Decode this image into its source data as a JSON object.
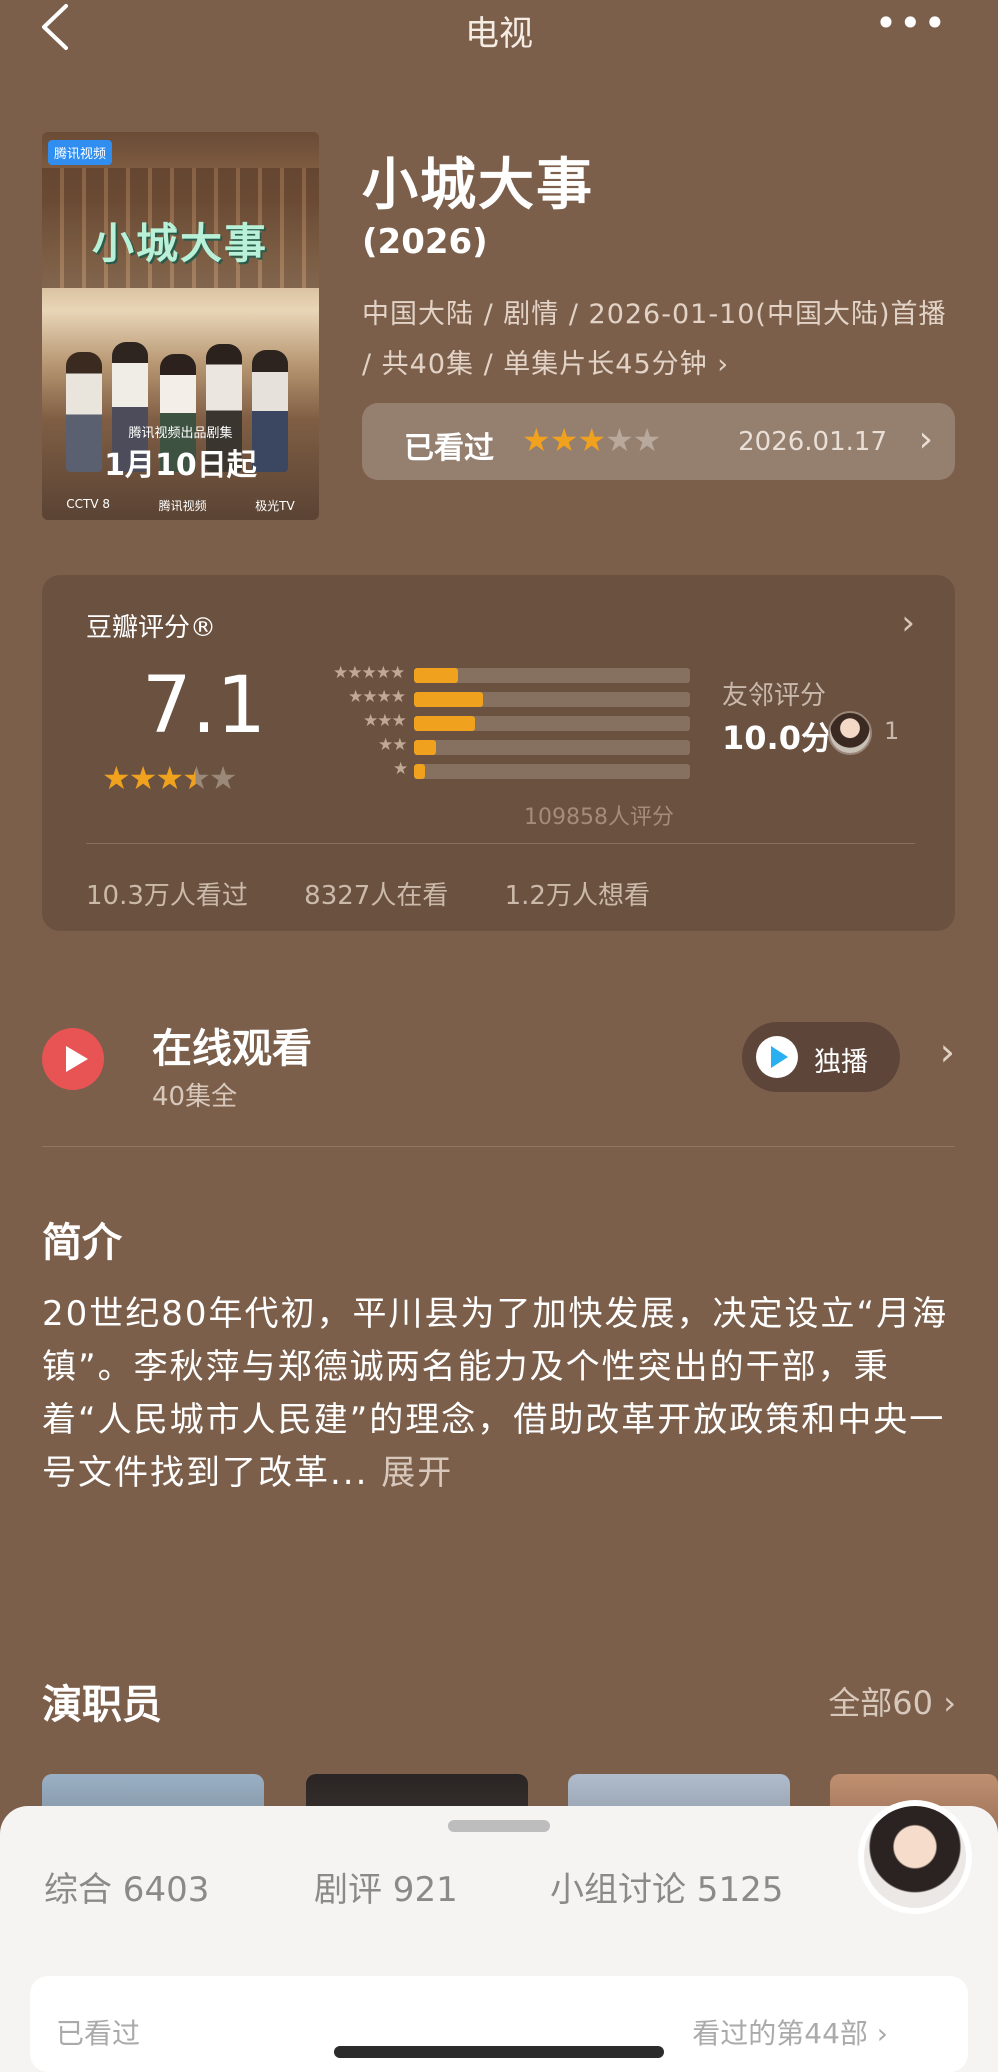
{
  "header": {
    "title": "电视",
    "more": "•••"
  },
  "poster": {
    "tag": "腾讯视频",
    "logo": "小城大事",
    "caption_small": "腾讯视频出品剧集",
    "caption_date": "1月10日起",
    "footer": [
      "CCTV 8",
      "腾讯视频",
      "极光TV"
    ]
  },
  "show": {
    "title": "小城大事",
    "year": "(2026)",
    "meta": "中国大陆 / 剧情 / 2026-01-10(中国大陆)首播 / 共40集 / 单集片长45分钟 ›"
  },
  "watched": {
    "label": "已看过",
    "user_stars": 3,
    "max_stars": 5,
    "date": "2026.01.17",
    "chevron": "›"
  },
  "rating": {
    "label": "豆瓣评分®",
    "score": "7.1",
    "stars": 3.5,
    "distribution": [
      {
        "stars": "★★★★★",
        "fraction": 0.16
      },
      {
        "stars": "★★★★",
        "fraction": 0.25
      },
      {
        "stars": "★★★",
        "fraction": 0.22
      },
      {
        "stars": "★★",
        "fraction": 0.08
      },
      {
        "stars": "★",
        "fraction": 0.04
      }
    ],
    "count": "109858人评分",
    "friends_label": "友邻评分",
    "friends_score": "10.0分",
    "friends_count": "1",
    "stats": [
      "10.3万人看过",
      "8327人在看",
      "1.2万人想看"
    ],
    "chevron": "›"
  },
  "online": {
    "title": "在线观看",
    "subtitle": "40集全",
    "badge": "独播",
    "chevron": "›"
  },
  "intro": {
    "heading": "简介",
    "text": "20世纪80年代初，平川县为了加快发展，决定设立“月海镇”。李秋萍与郑德诚两名能力及个性突出的干部，秉着“人民城市人民建”的理念，借助改革开放政策和中央一号文件找到了改革...",
    "more": "展开"
  },
  "cast": {
    "heading": "演职员",
    "all": "全部60 ›"
  },
  "sheet": {
    "tabs": [
      "综合 6403",
      "剧评 921",
      "小组讨论 5125"
    ],
    "card_left": "已看过",
    "card_right": "看过的第44部 ›"
  },
  "colors": {
    "background": "#7b5f4b",
    "accent_orange": "#f0a21e",
    "play_red": "#e85454"
  }
}
